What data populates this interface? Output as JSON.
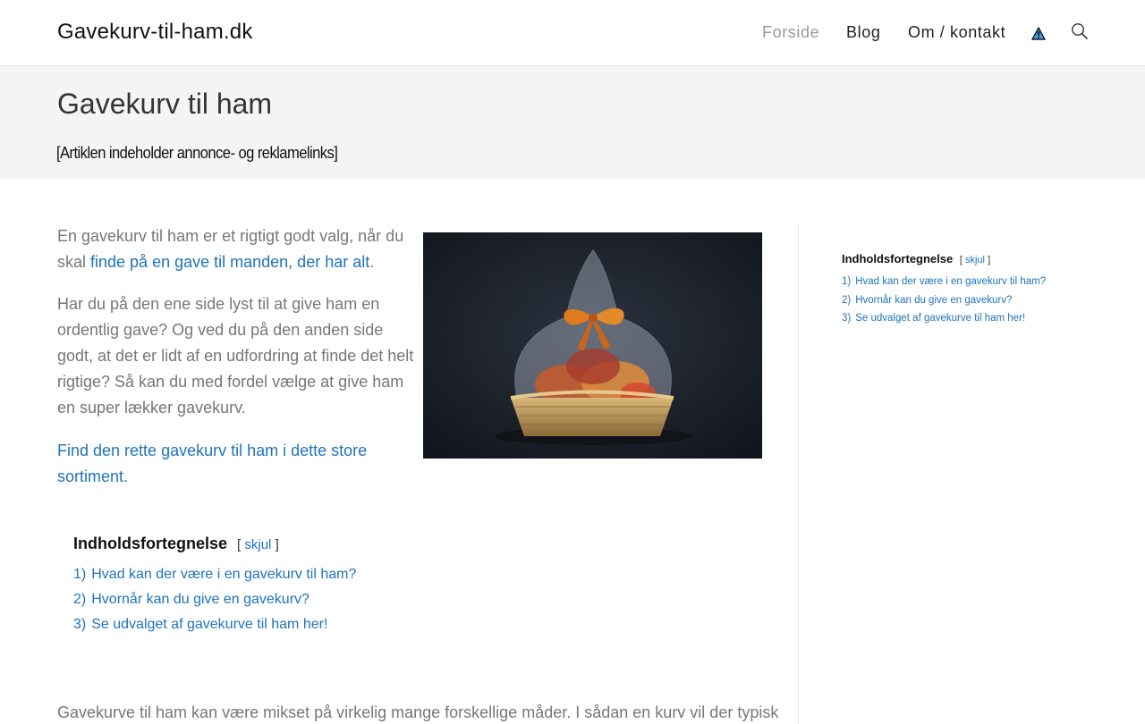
{
  "header": {
    "site_title": "Gavekurv-til-ham.dk",
    "nav": [
      {
        "label": "Forside",
        "active": true
      },
      {
        "label": "Blog",
        "active": false
      },
      {
        "label": "Om / kontakt",
        "active": false
      }
    ],
    "icons": [
      "warning-icon",
      "search-icon"
    ]
  },
  "title_band": {
    "title": "Gavekurv til ham",
    "disclaimer": "[Artiklen indeholder annonce- og reklamelinks]"
  },
  "article": {
    "p1_text": "En gavekurv til ham er et rigtigt godt valg, når du skal ",
    "p1_link": "finde på en gave til manden, der har alt",
    "p1_end": ".",
    "p2": "Har du på den ene side lyst til at give ham en ordentlig gave? Og ved du på den anden side godt, at det er lidt af en udfordring at finde det helt rigtige? Så kan du med fordel vælge at give ham en super lækker gavekurv.",
    "p3_link": "Find den rette gavekurv til ham i dette store sortiment",
    "p3_end": ".",
    "cut_text": "Gavekurve til ham kan være mikset på virkelig mange forskellige måder. I sådan en kurv vil der typisk"
  },
  "toc": {
    "heading": "Indholdsfortegnelse",
    "toggle_open": "[",
    "toggle_label": "skjul",
    "toggle_close": "]",
    "items": [
      {
        "num": "1)",
        "label": "Hvad kan der være i en gavekurv til ham?"
      },
      {
        "num": "2)",
        "label": "Hvornår kan du give en gavekurv?"
      },
      {
        "num": "3)",
        "label": "Se udvalget af gavekurve til ham her!"
      }
    ]
  },
  "colors": {
    "link": "#1e73be",
    "body_text": "#777777",
    "band_bg": "#f4f4f4"
  }
}
